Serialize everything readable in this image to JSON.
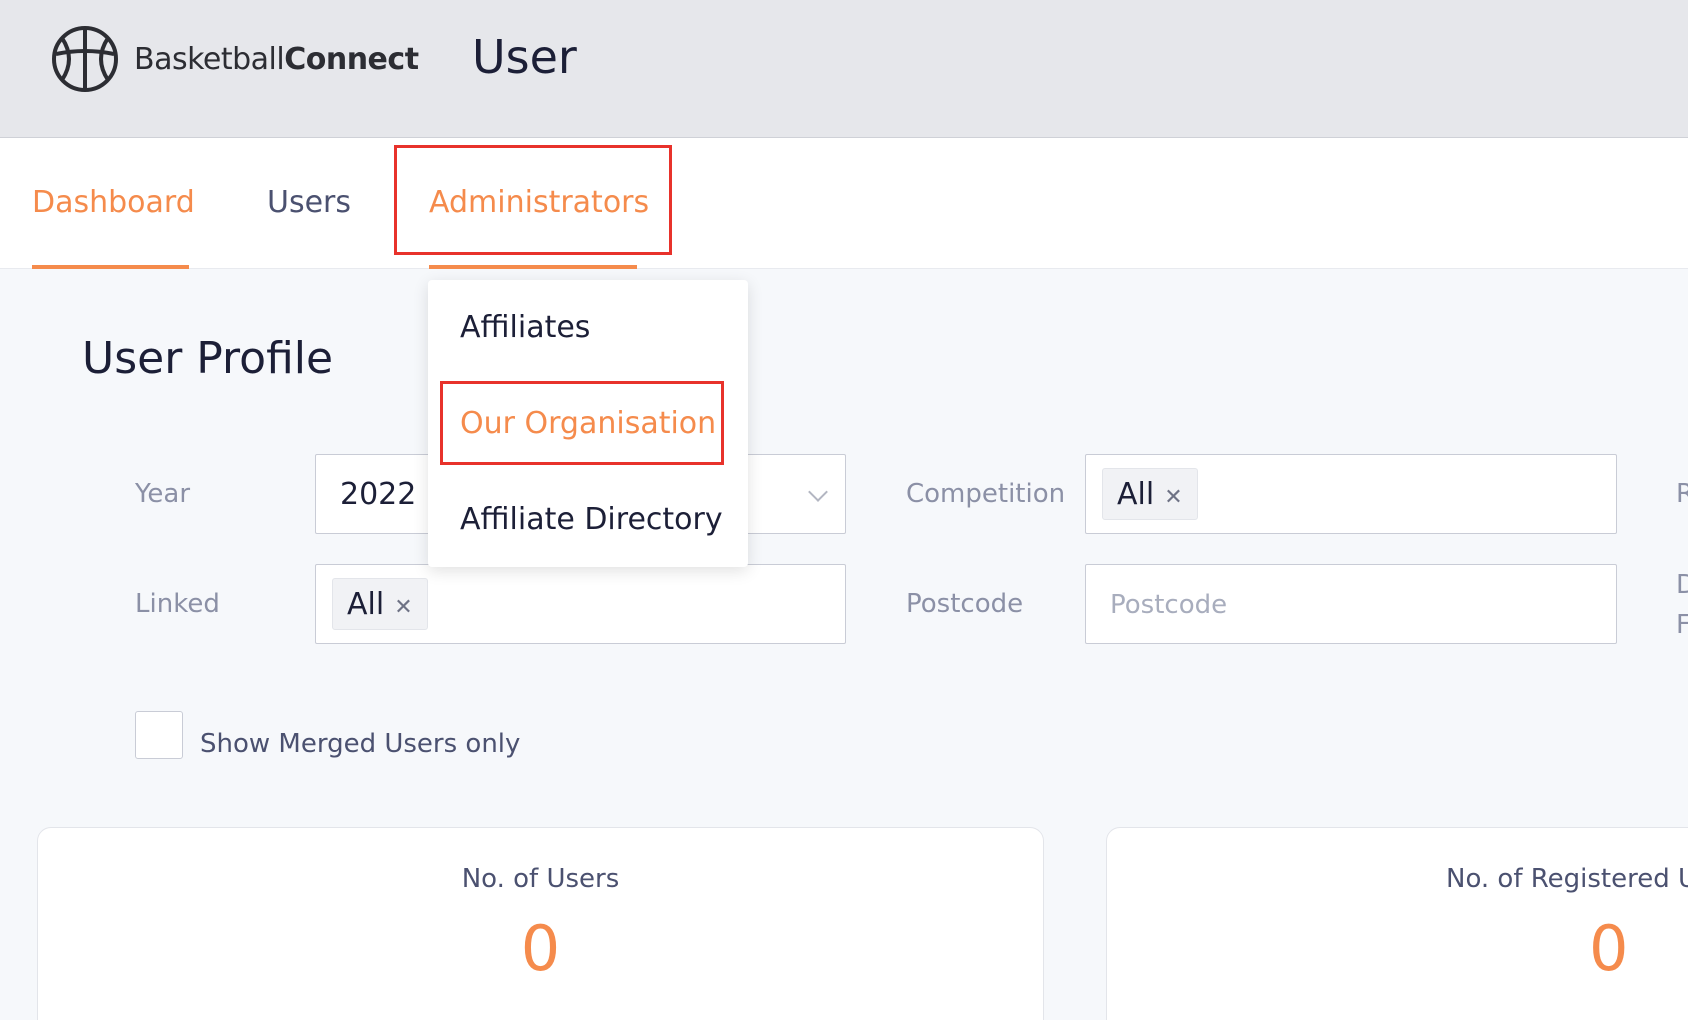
{
  "header": {
    "logo_text_light": "Basketball",
    "logo_text_bold": "Connect",
    "title": "User"
  },
  "nav": {
    "items": [
      {
        "label": "Dashboard",
        "active": true
      },
      {
        "label": "Users",
        "active": false
      },
      {
        "label": "Administrators",
        "active": true
      }
    ]
  },
  "dropdown": {
    "items": [
      {
        "label": "Affiliates"
      },
      {
        "label": "Our Organisation",
        "highlighted": true
      },
      {
        "label": "Affiliate Directory"
      }
    ]
  },
  "main": {
    "title": "User Profile",
    "filters": {
      "year": {
        "label": "Year",
        "value": "2022"
      },
      "competition": {
        "label": "Competition",
        "value": "All"
      },
      "linked": {
        "label": "Linked",
        "value": "All"
      },
      "postcode": {
        "label": "Postcode",
        "placeholder": "Postcode",
        "value": ""
      }
    },
    "clipped_labels": [
      "R",
      "D",
      "F"
    ],
    "merged_checkbox": {
      "label": "Show Merged Users only",
      "checked": false
    },
    "stats": [
      {
        "label": "No. of Users",
        "value": "0"
      },
      {
        "label": "No. of Registered Us",
        "value": "0"
      }
    ]
  },
  "colors": {
    "accent": "#f58b4c",
    "highlight_box": "#e8322b",
    "header_bg": "#e6e7eb"
  }
}
